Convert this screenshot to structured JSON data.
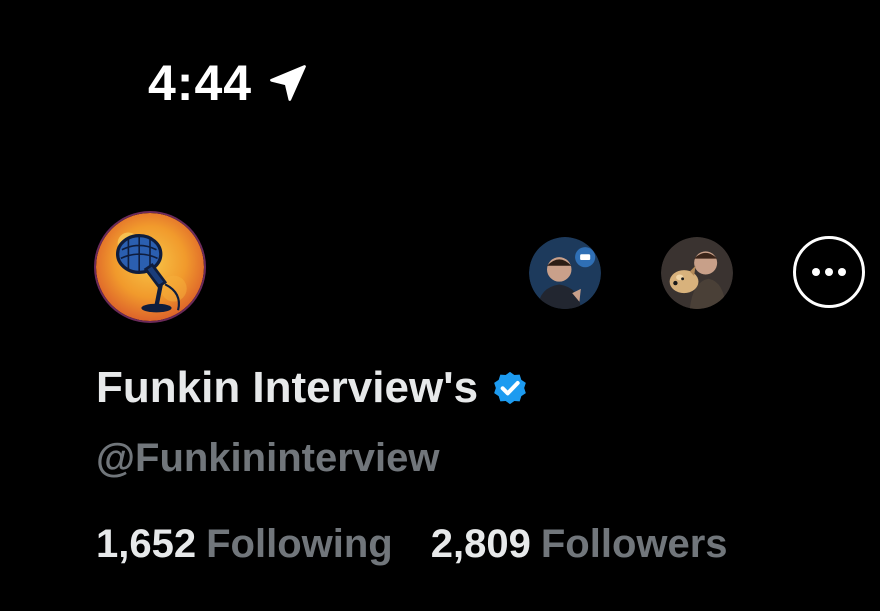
{
  "status_bar": {
    "time": "4:44",
    "location_icon": "location-arrow-icon"
  },
  "profile": {
    "display_name": "Funkin Interview's",
    "handle": "@Funkininterview",
    "verified": true,
    "verified_color": "#1d9bf0",
    "avatar_icon": "microphone-avatar"
  },
  "mutual_followers": [
    {
      "avatar": "mutual-follower-avatar-1"
    },
    {
      "avatar": "mutual-follower-avatar-2"
    }
  ],
  "actions": {
    "more_icon": "more-options-icon"
  },
  "stats": {
    "following_count": "1,652",
    "following_label": "Following",
    "followers_count": "2,809",
    "followers_label": "Followers"
  },
  "colors": {
    "background": "#000000",
    "primary_text": "#e7e9ea",
    "secondary_text": "#71767b"
  }
}
